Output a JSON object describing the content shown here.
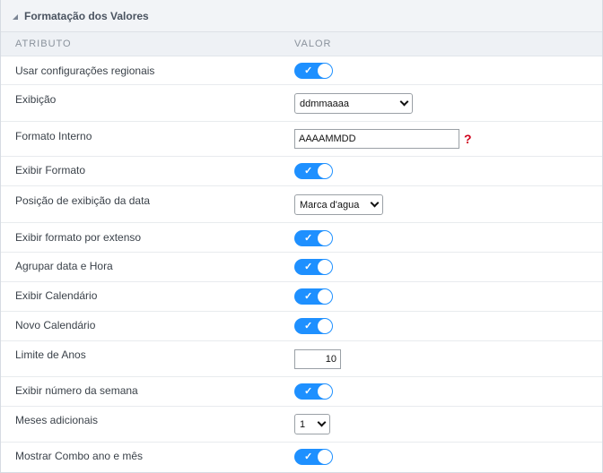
{
  "panel": {
    "title": "Formatação dos Valores"
  },
  "columns": {
    "attribute": "ATRIBUTO",
    "value": "VALOR"
  },
  "rows": {
    "regional": {
      "label": "Usar configurações regionais",
      "on": true
    },
    "exibicao": {
      "label": "Exibição",
      "selected": "ddmmaaaa"
    },
    "formato_interno": {
      "label": "Formato Interno",
      "value": "AAAAMMDD",
      "help": "?"
    },
    "exibir_formato": {
      "label": "Exibir Formato",
      "on": true
    },
    "posicao": {
      "label": "Posição de exibição da data",
      "selected": "Marca d'agua"
    },
    "extenso": {
      "label": "Exibir formato por extenso",
      "on": true
    },
    "agrupar": {
      "label": "Agrupar data e Hora",
      "on": true
    },
    "calendario": {
      "label": "Exibir Calendário",
      "on": true
    },
    "novo_calendario": {
      "label": "Novo Calendário",
      "on": true
    },
    "limite_anos": {
      "label": "Limite de Anos",
      "value": "10"
    },
    "semana": {
      "label": "Exibir número da semana",
      "on": true
    },
    "meses": {
      "label": "Meses adicionais",
      "selected": "1"
    },
    "combo": {
      "label": "Mostrar Combo ano e mês",
      "on": true
    }
  },
  "colors": {
    "toggle_on": "#1e90ff",
    "help": "#d0021b"
  }
}
